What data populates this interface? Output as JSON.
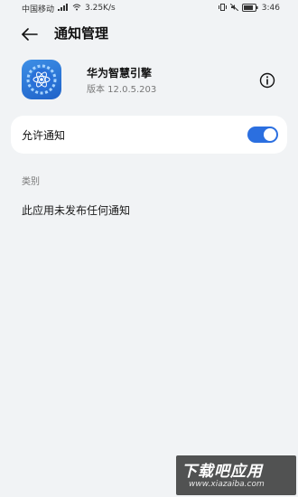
{
  "status_bar": {
    "carrier": "中国移动",
    "speed": "3.25K/s",
    "battery": "68",
    "time": "3:46",
    "icons": [
      "signal-icon",
      "wifi-icon",
      "vibrate-icon",
      "mute-icon",
      "battery-icon"
    ]
  },
  "header": {
    "title": "通知管理"
  },
  "app": {
    "name": "华为智慧引擎",
    "version": "版本 12.0.5.203",
    "icon": "atom-gear-icon"
  },
  "allow_notifications": {
    "label": "允许通知",
    "enabled": true
  },
  "categories": {
    "label": "类别",
    "empty_message": "此应用未发布任何通知"
  },
  "watermark": {
    "main": "下载吧应用",
    "sub": "www.xiazaiba.com"
  },
  "colors": {
    "background": "#f1f3f5",
    "accent": "#2b6fe0",
    "card": "#ffffff"
  }
}
